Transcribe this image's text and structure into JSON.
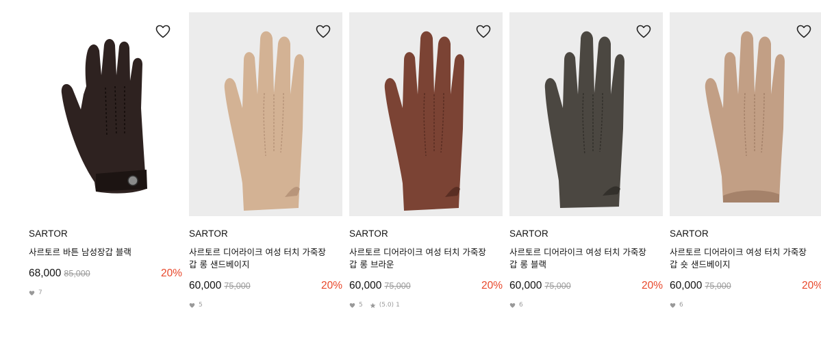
{
  "products": [
    {
      "brand": "SARTOR",
      "name": "사르토르 바튼 남성장갑 블랙",
      "price": "68,000",
      "original_price": "85,000",
      "discount": "20%",
      "likes": "7",
      "glove_color": "#2e2220",
      "glove_shade": "#1c1412",
      "background": "#ffffff",
      "icon": "heart-outline-icon"
    },
    {
      "brand": "SARTOR",
      "name": "사르토르 디어라이크 여성 터치 가죽장갑 롱 샌드베이지",
      "price": "60,000",
      "original_price": "75,000",
      "discount": "20%",
      "likes": "5",
      "glove_color": "#d3b294",
      "glove_shade": "#b8957a",
      "background": "#ececec",
      "icon": "heart-outline-icon"
    },
    {
      "brand": "SARTOR",
      "name": "사르토르 디어라이크 여성 터치 가죽장갑 롱 브라운",
      "price": "60,000",
      "original_price": "75,000",
      "discount": "20%",
      "likes": "5",
      "rating": "(5.0)",
      "reviews": "1",
      "glove_color": "#7b4334",
      "glove_shade": "#5a2e23",
      "background": "#ececec",
      "icon": "heart-outline-icon"
    },
    {
      "brand": "SARTOR",
      "name": "사르토르 디어라이크 여성 터치 가죽장갑 롱 블랙",
      "price": "60,000",
      "original_price": "75,000",
      "discount": "20%",
      "likes": "6",
      "glove_color": "#4b4741",
      "glove_shade": "#33302b",
      "background": "#ececec",
      "icon": "heart-outline-icon"
    },
    {
      "brand": "SARTOR",
      "name": "사르토르 디어라이크 여성 터치 가죽장갑 숏 샌드베이지",
      "price": "60,000",
      "original_price": "75,000",
      "discount": "20%",
      "likes": "6",
      "glove_color": "#c29f85",
      "glove_shade": "#a5826a",
      "background": "#ececec",
      "icon": "heart-outline-icon"
    }
  ]
}
